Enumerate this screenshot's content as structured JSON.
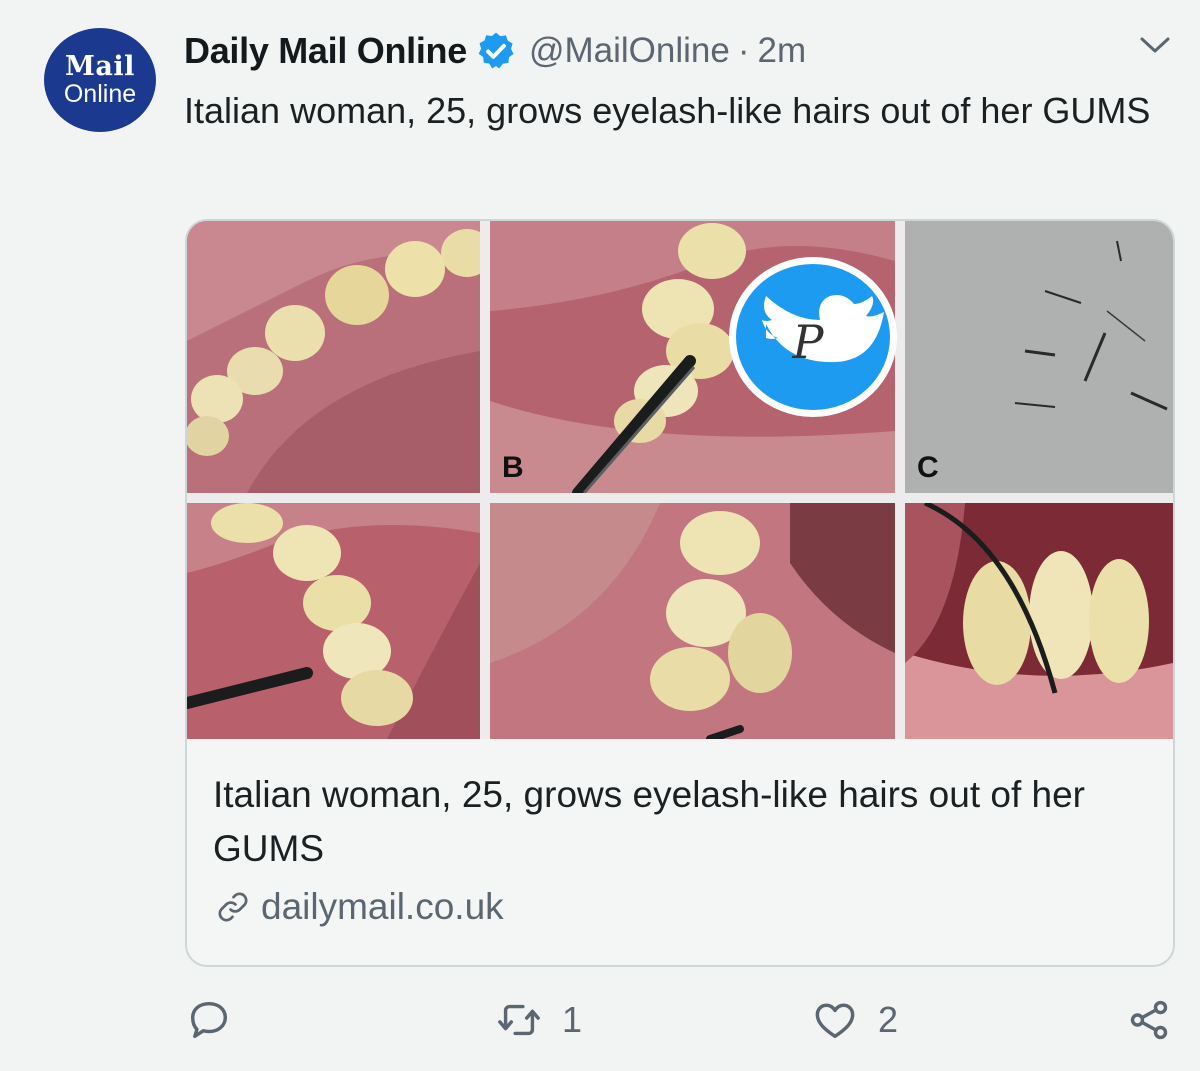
{
  "tweet": {
    "avatar": {
      "line1": "Mail",
      "line2": "Online",
      "bg": "#1b3a8f"
    },
    "display_name": "Daily Mail Online",
    "verified_icon": "verified-badge-icon",
    "handle": "@MailOnline",
    "separator": "·",
    "time": "2m",
    "text": "Italian woman, 25, grows eyelash-like hairs out of her GUMS",
    "card": {
      "panel_labels": [
        "B",
        "C"
      ],
      "title": "Italian woman, 25, grows eyelash-like hairs out of her GUMS",
      "domain": "dailymail.co.uk",
      "watermark_letter": "P"
    },
    "actions": {
      "reply": {
        "icon": "reply-icon",
        "count": ""
      },
      "retweet": {
        "icon": "retweet-icon",
        "count": "1"
      },
      "like": {
        "icon": "heart-icon",
        "count": "2"
      },
      "share": {
        "icon": "share-icon"
      }
    },
    "colors": {
      "verified": "#1d9bf0",
      "secondary_text": "#5b6670",
      "watermark_bg": "#1d9bf0"
    }
  }
}
